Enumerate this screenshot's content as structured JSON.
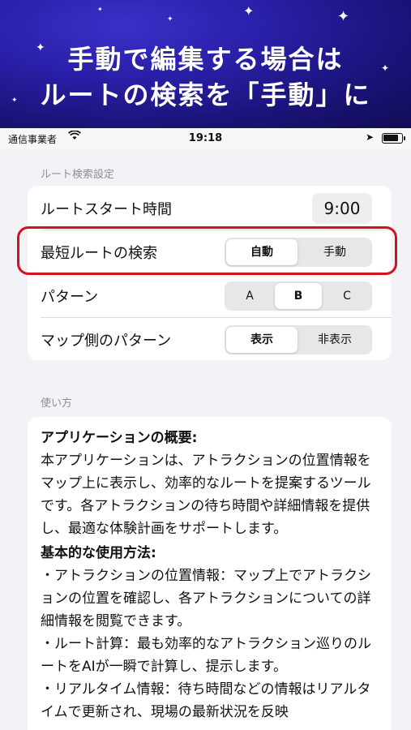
{
  "banner": {
    "line1": "手動で編集する場合は",
    "line2": "ルートの検索を「手動」に"
  },
  "statusbar": {
    "carrier": "通信事業者",
    "time": "19:18"
  },
  "route_settings": {
    "header": "ルート検索設定",
    "start_time": {
      "label": "ルートスタート時間",
      "value": "9:00"
    },
    "shortest": {
      "label": "最短ルートの検索",
      "options": [
        "自動",
        "手動"
      ],
      "selected": "自動"
    },
    "pattern": {
      "label": "パターン",
      "options": [
        "A",
        "B",
        "C"
      ],
      "selected": "B"
    },
    "map_pattern": {
      "label": "マップ側のパターン",
      "options": [
        "表示",
        "非表示"
      ],
      "selected": "表示"
    }
  },
  "usage": {
    "header": "使い方",
    "overview_title": "アプリケーションの概要:",
    "overview_body": "本アプリケーションは、アトラクションの位置情報をマップ上に表示し、効率的なルートを提案するツールです。各アトラクションの待ち時間や詳細情報を提供し、最適な体験計画をサポートします。",
    "basic_title": "基本的な使用方法:",
    "basic_items": [
      "・アトラクションの位置情報：マップ上でアトラクションの位置を確認し、各アトラクションについての詳細情報を閲覧できます。",
      "・ルート計算：最も効率的なアトラクション巡りのルートをAIが一瞬で計算し、提示します。",
      "・リアルタイム情報：待ち時間などの情報はリアルタイムで更新され、現場の最新状況を反映"
    ]
  },
  "colors": {
    "highlight": "#d0141e",
    "banner_bg": "#2a1fa8"
  }
}
